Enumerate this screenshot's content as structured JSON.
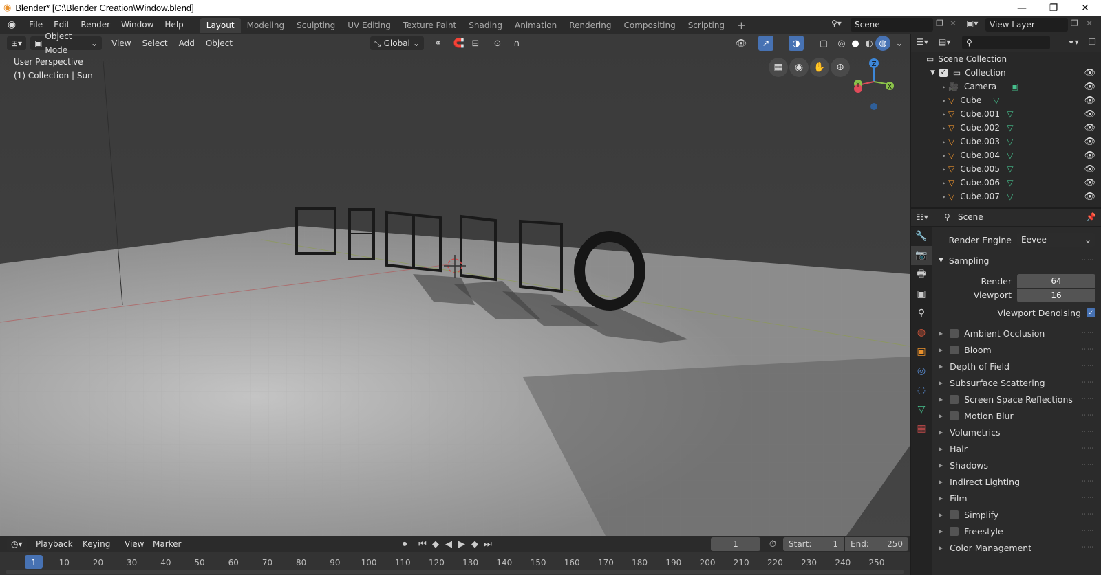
{
  "window": {
    "title": "Blender* [C:\\Blender Creation\\Window.blend]",
    "minimize": "—",
    "restore": "❐",
    "close": "✕"
  },
  "menus": [
    "File",
    "Edit",
    "Render",
    "Window",
    "Help"
  ],
  "workspaces": [
    "Layout",
    "Modeling",
    "Sculpting",
    "UV Editing",
    "Texture Paint",
    "Shading",
    "Animation",
    "Rendering",
    "Compositing",
    "Scripting"
  ],
  "active_workspace": "Layout",
  "add_workspace": "+",
  "scene_field": "Scene",
  "view_layer_field": "View Layer",
  "viewport": {
    "mode": "Object Mode",
    "menus": [
      "View",
      "Select",
      "Add",
      "Object"
    ],
    "transform": "Global",
    "info_line1": "User Perspective",
    "info_line2": "(1) Collection | Sun",
    "gizmo": {
      "z": "Z",
      "y": "Y",
      "x": "X"
    }
  },
  "outliner": {
    "root": "Scene Collection",
    "collection": "Collection",
    "items": [
      "Camera",
      "Cube",
      "Cube.001",
      "Cube.002",
      "Cube.003",
      "Cube.004",
      "Cube.005",
      "Cube.006",
      "Cube.007"
    ]
  },
  "properties": {
    "header": "Scene",
    "render_engine_label": "Render Engine",
    "render_engine_value": "Eevee",
    "sampling_label": "Sampling",
    "render_label": "Render",
    "render_value": "64",
    "viewport_label": "Viewport",
    "viewport_value": "16",
    "denoise_label": "Viewport Denoising",
    "panels": [
      {
        "label": "Ambient Occlusion",
        "checkbox": true
      },
      {
        "label": "Bloom",
        "checkbox": true
      },
      {
        "label": "Depth of Field",
        "checkbox": false
      },
      {
        "label": "Subsurface Scattering",
        "checkbox": false
      },
      {
        "label": "Screen Space Reflections",
        "checkbox": true
      },
      {
        "label": "Motion Blur",
        "checkbox": true
      },
      {
        "label": "Volumetrics",
        "checkbox": false
      },
      {
        "label": "Hair",
        "checkbox": false
      },
      {
        "label": "Shadows",
        "checkbox": false
      },
      {
        "label": "Indirect Lighting",
        "checkbox": false
      },
      {
        "label": "Film",
        "checkbox": false
      },
      {
        "label": "Simplify",
        "checkbox": true
      },
      {
        "label": "Freestyle",
        "checkbox": true
      },
      {
        "label": "Color Management",
        "checkbox": false
      }
    ]
  },
  "timeline": {
    "menus": [
      "Playback",
      "Keying",
      "View",
      "Marker"
    ],
    "current_frame": "1",
    "start_label": "Start:",
    "start_value": "1",
    "end_label": "End:",
    "end_value": "250",
    "ticks": [
      "1",
      "10",
      "20",
      "30",
      "40",
      "50",
      "60",
      "70",
      "80",
      "90",
      "100",
      "110",
      "120",
      "130",
      "140",
      "150",
      "160",
      "170",
      "180",
      "190",
      "200",
      "210",
      "220",
      "230",
      "240",
      "250"
    ]
  },
  "colors": {
    "accent": "#4772b3",
    "object_orange": "#e8902c",
    "mesh_green": "#46c08d",
    "x_red": "#e04b5a",
    "y_green": "#8bc34a",
    "z_blue": "#3d87d8"
  }
}
